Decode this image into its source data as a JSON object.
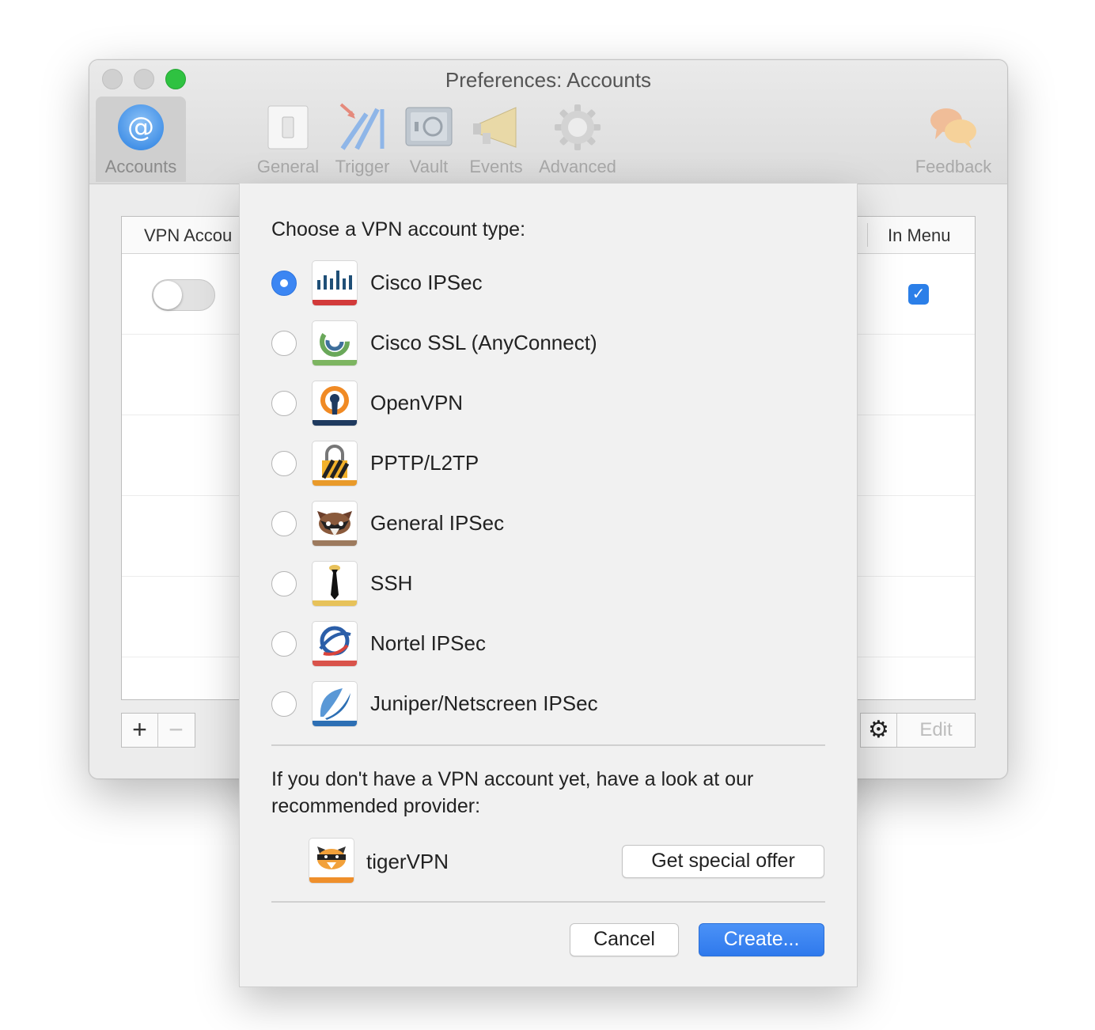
{
  "window": {
    "title": "Preferences: Accounts"
  },
  "toolbar": {
    "items": [
      {
        "label": "Accounts",
        "icon": "at-sign-icon"
      },
      {
        "label": "General",
        "icon": "light-switch-icon"
      },
      {
        "label": "Trigger",
        "icon": "trigger-icon"
      },
      {
        "label": "Vault",
        "icon": "safe-icon"
      },
      {
        "label": "Events",
        "icon": "megaphone-icon"
      },
      {
        "label": "Advanced",
        "icon": "gear-icon"
      },
      {
        "label": "Feedback",
        "icon": "speech-bubbles-icon"
      }
    ]
  },
  "table": {
    "col_vpn": "VPN Accou",
    "col_in_menu": "In Menu",
    "check_glyph": "✓"
  },
  "bottom_bar": {
    "add": "+",
    "remove": "−",
    "gear": "⚙",
    "edit": "Edit"
  },
  "sheet": {
    "prompt": "Choose a VPN account type:",
    "options": [
      {
        "label": "Cisco IPSec",
        "selected": true
      },
      {
        "label": "Cisco SSL (AnyConnect)",
        "selected": false
      },
      {
        "label": "OpenVPN",
        "selected": false
      },
      {
        "label": "PPTP/L2TP",
        "selected": false
      },
      {
        "label": "General IPSec",
        "selected": false
      },
      {
        "label": "SSH",
        "selected": false
      },
      {
        "label": "Nortel IPSec",
        "selected": false
      },
      {
        "label": "Juniper/Netscreen IPSec",
        "selected": false
      }
    ],
    "promo_text": "If you don't have a VPN account yet, have a look at our recommended provider:",
    "provider": "tigerVPN",
    "offer_button": "Get special offer",
    "cancel_button": "Cancel",
    "create_button": "Create..."
  },
  "colors": {
    "accent": "#3c86f3",
    "zoom_green": "#2fc241"
  }
}
